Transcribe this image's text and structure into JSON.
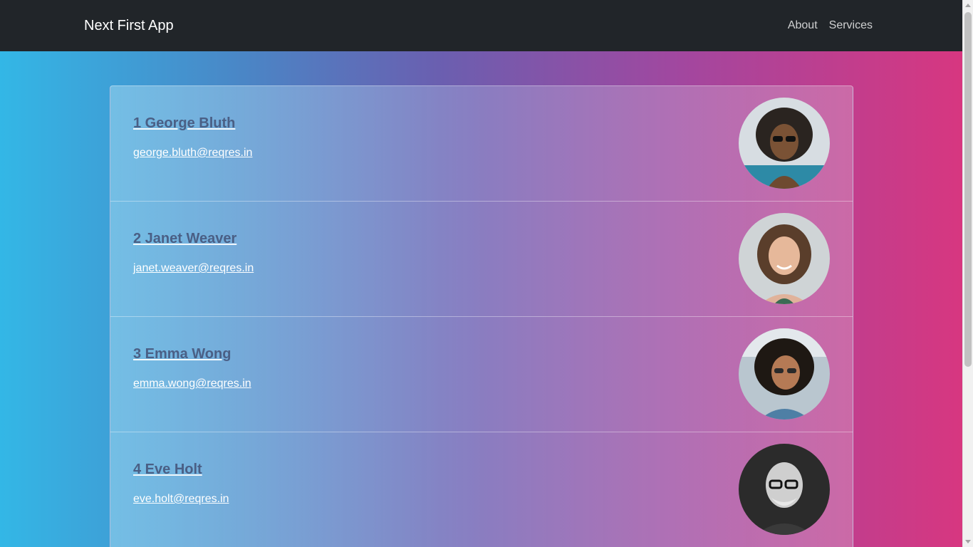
{
  "navbar": {
    "brand": "Next First App",
    "links": [
      "About",
      "Services"
    ]
  },
  "users": [
    {
      "id_name": "1 George Bluth",
      "email": "george.bluth@reqres.in"
    },
    {
      "id_name": "2 Janet Weaver",
      "email": "janet.weaver@reqres.in"
    },
    {
      "id_name": "3 Emma Wong",
      "email": "emma.wong@reqres.in"
    },
    {
      "id_name": "4 Eve Holt",
      "email": "eve.holt@reqres.in"
    }
  ],
  "colors": {
    "navbar_bg": "#212529",
    "gradient_left": "#33b7e6",
    "gradient_right": "#d9367f",
    "name_text": "#4a5f85"
  }
}
